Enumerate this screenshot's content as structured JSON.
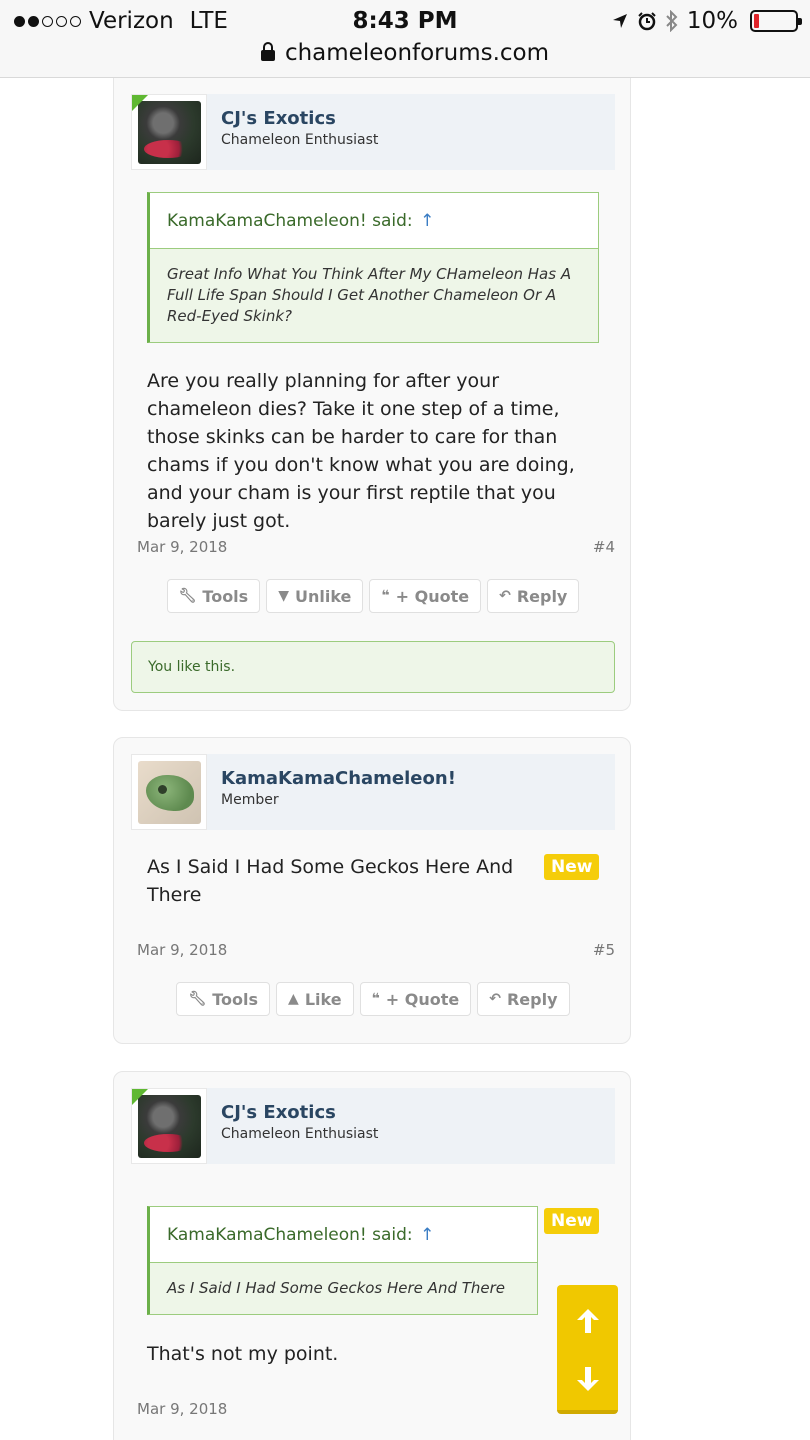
{
  "status_bar": {
    "carrier": "Verizon",
    "network": "LTE",
    "time": "8:43 PM",
    "battery": "10%",
    "url": "chameleonforums.com"
  },
  "posts": [
    {
      "username": "CJ's Exotics",
      "user_title": "Chameleon Enthusiast",
      "quote_author": "KamaKamaChameleon! said:",
      "quote_arrow": "↑",
      "quote_text": "Great Info What You Think After My CHameleon Has A Full Life Span Should I Get Another Chameleon Or A Red-Eyed Skink?",
      "message": "Are you really planning for after your chameleon dies? Take it one step of a time, those skinks can be harder to care for than chams if you don't know what you are doing, and your cham is your first reptile that you barely just got.",
      "date": "Mar 9, 2018",
      "post_number": "#4",
      "actions": {
        "tools": "Tools",
        "like": "Unlike",
        "quote": "+ Quote",
        "reply": "Reply"
      },
      "liked_notice": "You like this."
    },
    {
      "username": "KamaKamaChameleon!",
      "user_title": "Member",
      "message": "As I Said I Had Some Geckos Here And There",
      "badge": "New",
      "date": "Mar 9, 2018",
      "post_number": "#5",
      "actions": {
        "tools": "Tools",
        "like": "Like",
        "quote": "+ Quote",
        "reply": "Reply"
      }
    },
    {
      "username": "CJ's Exotics",
      "user_title": "Chameleon Enthusiast",
      "badge": "New",
      "quote_author": "KamaKamaChameleon! said:",
      "quote_arrow": "↑",
      "quote_text": "As I Said I Had Some Geckos Here And There",
      "message": "That's not my point.",
      "date": "Mar 9, 2018"
    }
  ],
  "colors": {
    "accent_yellow": "#f5cd0a",
    "quote_green": "#6cb04a",
    "username_blue": "#2a4662"
  },
  "icons": [
    "lock-icon",
    "location-icon",
    "alarm-icon",
    "bluetooth-icon",
    "wrench-icon",
    "thumbs-down-icon",
    "thumbs-up-icon",
    "quote-icon",
    "reply-icon",
    "arrow-up-icon",
    "arrow-down-icon"
  ]
}
